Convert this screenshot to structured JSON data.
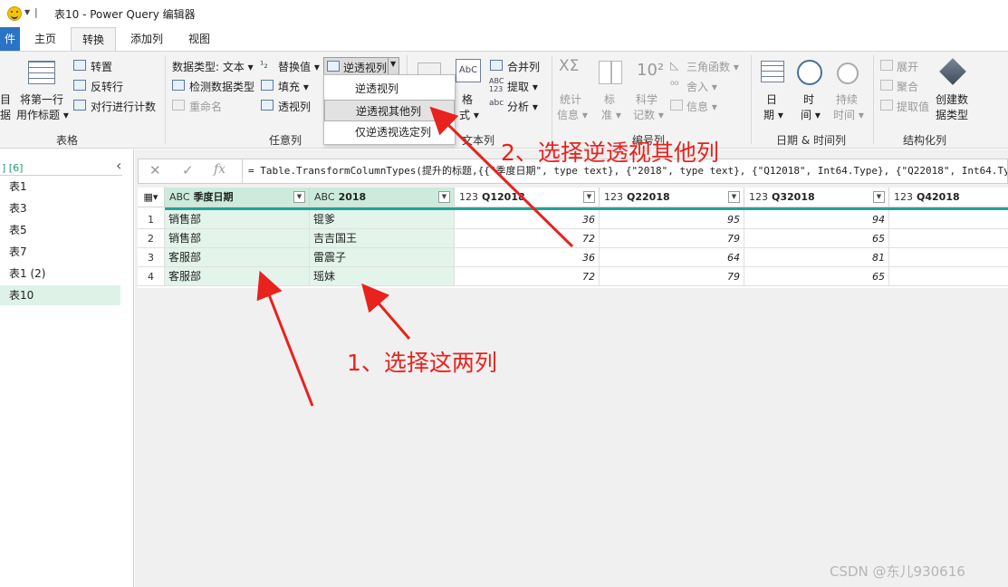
{
  "titlebar": {
    "title": "表10 - Power Query 编辑器"
  },
  "tabs": [
    {
      "label": "件"
    },
    {
      "label": "主页"
    },
    {
      "label": "转换"
    },
    {
      "label": "添加列"
    },
    {
      "label": "视图"
    }
  ],
  "ribbon": {
    "table_group": {
      "label": "表格",
      "edge_text": [
        "目",
        "据"
      ],
      "use_first_row": [
        "将第一行",
        "用作标题 ▾"
      ],
      "transpose": "转置",
      "reverse_rows": "反转行",
      "count_rows": "对行进行计数"
    },
    "any_column_group": {
      "label": "任意列",
      "data_type": "数据类型: 文本 ▾",
      "detect_type": "检测数据类型",
      "rename": "重命名",
      "replace_values": "替换值 ▾",
      "fill": "填充 ▾",
      "pivot_column": "透视列",
      "unpivot_columns": "逆透视列"
    },
    "unpivot_menu": {
      "items": [
        "逆透视列",
        "逆透视其他列",
        "仅逆透视选定列"
      ]
    },
    "text_column_group": {
      "label": "文本列",
      "format": [
        "格",
        "式 ▾"
      ],
      "merge_columns": "合并列",
      "extract": "提取 ▾",
      "parse": "分析 ▾"
    },
    "number_column_group": {
      "label": "编号列",
      "statistics": [
        "统计",
        "信息 ▾"
      ],
      "standard": [
        "标",
        "准 ▾"
      ],
      "scientific": [
        "科学",
        "记数 ▾"
      ],
      "trigonometry": "三角函数 ▾",
      "rounding": "舍入 ▾",
      "information": "信息 ▾"
    },
    "datetime_group": {
      "label": "日期 & 时间列",
      "date": [
        "日",
        "期 ▾"
      ],
      "time": [
        "时",
        "间 ▾"
      ],
      "duration": [
        "持续",
        "时间 ▾"
      ]
    },
    "structured_group": {
      "label": "结构化列",
      "expand": "展开",
      "aggregate": "聚合",
      "extract_values": "提取值",
      "create_data_type": [
        "创建数",
        "据类型"
      ]
    }
  },
  "queries": {
    "header": "] [6]",
    "items": [
      "表1",
      "表3",
      "表5",
      "表7",
      "表1 (2)",
      "表10"
    ]
  },
  "formula_bar": {
    "fx": "fx",
    "cancel": "✕",
    "confirm": "✓",
    "text": "= Table.TransformColumnTypes(提升的标题,{{\"季度日期\", type text}, {\"2018\", type text}, {\"Q12018\", Int64.Type}, {\"Q22018\", Int64.Type}"
  },
  "grid": {
    "columns": [
      {
        "type": "ABC",
        "name": "季度日期"
      },
      {
        "type": "ABC",
        "name": "2018"
      },
      {
        "type": "123",
        "name": "Q12018"
      },
      {
        "type": "123",
        "name": "Q22018"
      },
      {
        "type": "123",
        "name": "Q32018"
      },
      {
        "type": "123",
        "name": "Q42018"
      }
    ],
    "rows": [
      {
        "n": "1",
        "dept": "销售部",
        "name": "锟爹",
        "q1": "36",
        "q2": "95",
        "q3": "94"
      },
      {
        "n": "2",
        "dept": "销售部",
        "name": "吉吉国王",
        "q1": "72",
        "q2": "79",
        "q3": "65"
      },
      {
        "n": "3",
        "dept": "客服部",
        "name": "雷震子",
        "q1": "36",
        "q2": "64",
        "q3": "81"
      },
      {
        "n": "4",
        "dept": "客服部",
        "name": "瑶妹",
        "q1": "72",
        "q2": "79",
        "q3": "65"
      }
    ]
  },
  "annotations": {
    "step1": "1、选择这两列",
    "step2": "2、选择逆透视其他列"
  },
  "watermark": "CSDN @东儿930616",
  "colors": {
    "accent": "#1fa598",
    "file_tab": "#2b73c4",
    "annotation": "#e8221d",
    "selected_column": "#cdebdc"
  }
}
